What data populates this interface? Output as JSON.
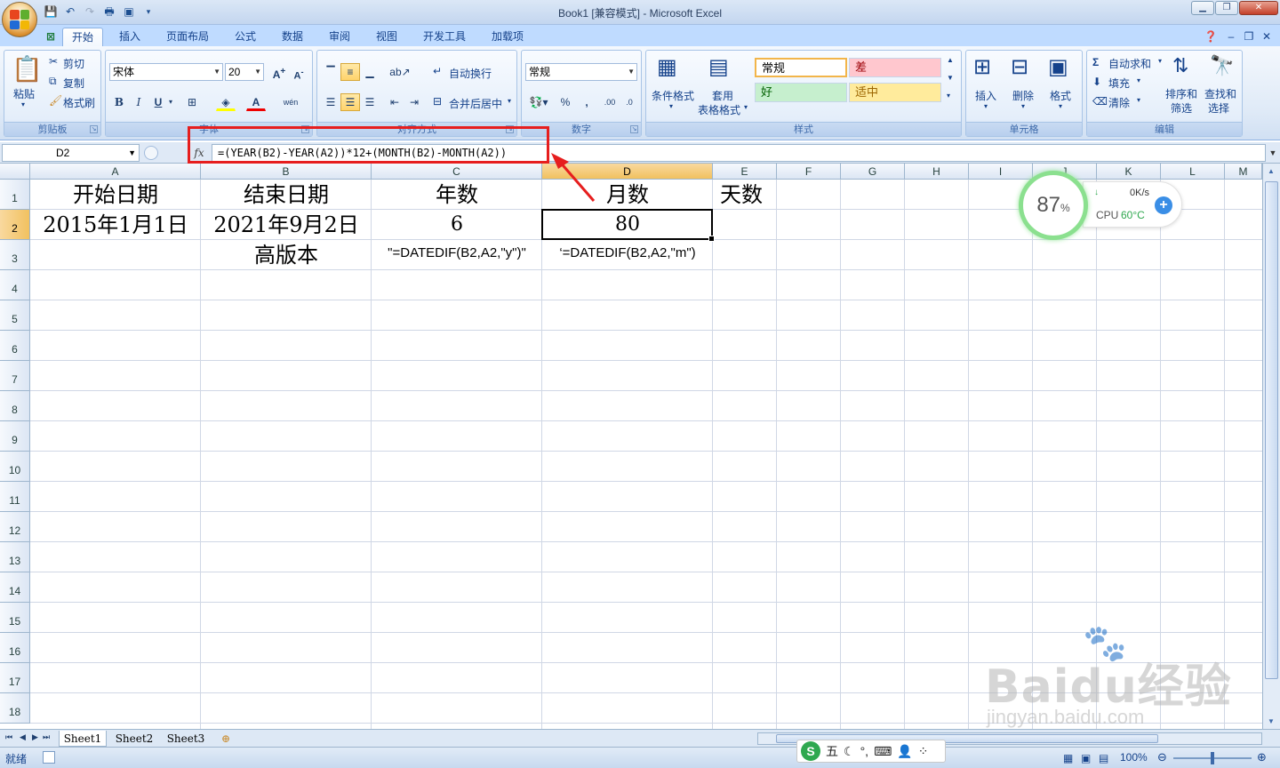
{
  "window": {
    "title": "Book1  [兼容模式] - Microsoft Excel"
  },
  "tabs": [
    "开始",
    "插入",
    "页面布局",
    "公式",
    "数据",
    "审阅",
    "视图",
    "开发工具",
    "加载项"
  ],
  "ribbon": {
    "clipboard": {
      "label": "剪贴板",
      "paste": "粘贴",
      "cut": "剪切",
      "copy": "复制",
      "format_painter": "格式刷"
    },
    "font": {
      "label": "字体",
      "name": "宋体",
      "size": "20",
      "bold": "B",
      "italic": "I",
      "underline": "U",
      "font_color": "A",
      "phonetic": "wén"
    },
    "alignment": {
      "label": "对齐方式",
      "wrap": "自动换行",
      "merge": "合并后居中"
    },
    "number": {
      "label": "数字",
      "format": "常规",
      "percent": "%",
      "comma": ",",
      "inc_dec": ".00",
      "dec_dec": ".0"
    },
    "styles": {
      "label": "样式",
      "conditional": "条件格式",
      "table_line1": "套用",
      "table_line2": "表格格式",
      "normal": "常规",
      "bad": "差",
      "good": "好",
      "neutral": "适中"
    },
    "cells": {
      "label": "单元格",
      "insert": "插入",
      "delete": "删除",
      "format": "格式"
    },
    "editing": {
      "label": "编辑",
      "autosum": "自动求和",
      "fill": "填充",
      "clear": "清除",
      "sort_line1": "排序和",
      "sort_line2": "筛选",
      "find_line1": "查找和",
      "find_line2": "选择"
    }
  },
  "formula_bar": {
    "name_box": "D2",
    "fx": "fx",
    "formula": "=(YEAR(B2)-YEAR(A2))*12+(MONTH(B2)-MONTH(A2))"
  },
  "columns": [
    "A",
    "B",
    "C",
    "D",
    "E",
    "F",
    "G",
    "H",
    "I",
    "J",
    "K",
    "L",
    "M"
  ],
  "rows": [
    "1",
    "2",
    "3",
    "4",
    "5",
    "6",
    "7",
    "8",
    "9",
    "10",
    "11",
    "12",
    "13",
    "14",
    "15",
    "16",
    "17",
    "18"
  ],
  "cells": {
    "A1": "开始日期",
    "B1": "结束日期",
    "C1": "年数",
    "D1": "月数",
    "E1": "天数",
    "A2": "2015年1月1日",
    "B2": "2021年9月2日",
    "C2": "6",
    "D2": "80",
    "B3": "高版本",
    "C3": "\"=DATEDIF(B2,A2,\"y\")\"",
    "D3": "‘=DATEDIF(B2,A2,\"m\")"
  },
  "sheet_tabs": [
    "Sheet1",
    "Sheet2",
    "Sheet3"
  ],
  "status": {
    "ready": "就绪",
    "zoom": "100%"
  },
  "cpu_widget": {
    "percent": "87",
    "unit": "%",
    "net": "0K/s",
    "cpu_label": "CPU",
    "temp": "60°C"
  },
  "ime": {
    "logo": "S",
    "mode": "五"
  },
  "watermark": {
    "brand": "Baidu经验",
    "url": "jingyan.baidu.com"
  },
  "colors": {
    "ribbon_bg": "#dfeaf7",
    "highlight": "#e61e1e",
    "selected_header": "#f1c15f",
    "cpu_ring": "#8be08f"
  }
}
